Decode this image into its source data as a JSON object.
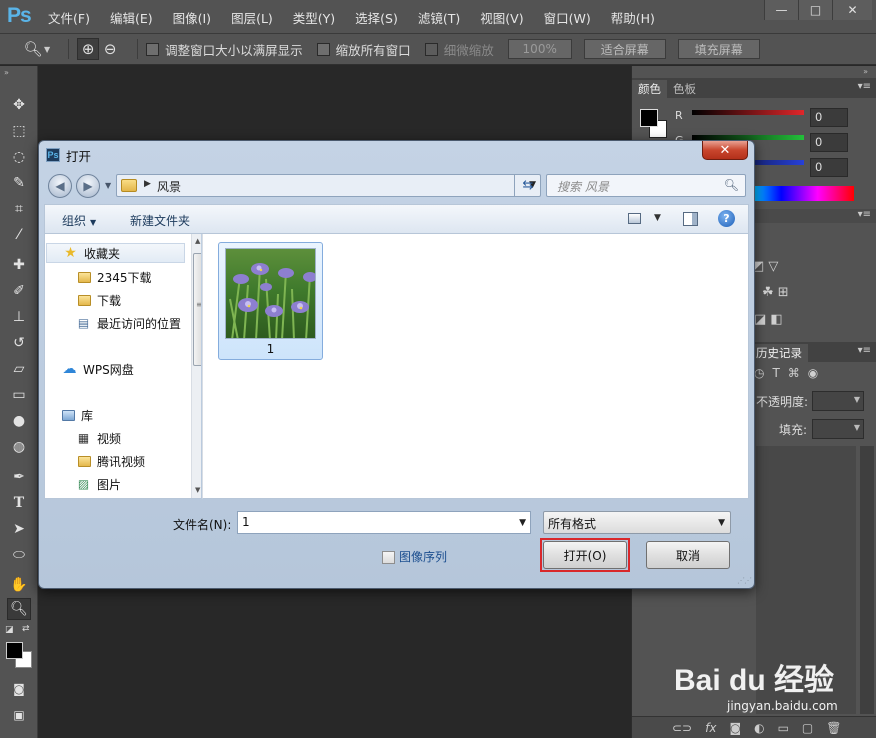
{
  "app": {
    "logo": "Ps",
    "menu": [
      "文件(F)",
      "编辑(E)",
      "图像(I)",
      "图层(L)",
      "类型(Y)",
      "选择(S)",
      "滤镜(T)",
      "视图(V)",
      "窗口(W)",
      "帮助(H)"
    ],
    "window_controls": {
      "minimize": "—",
      "maximize": "□",
      "close": "✕"
    }
  },
  "options_bar": {
    "resize_windows": "调整窗口大小以满屏显示",
    "zoom_all": "缩放所有窗口",
    "scrubby_zoom": "细微缩放",
    "zoom_value": "100%",
    "fit_screen": "适合屏幕",
    "fill_screen": "填充屏幕"
  },
  "color_panel": {
    "tabs": [
      "颜色",
      "色板"
    ],
    "channels": [
      {
        "label": "R",
        "value": "0",
        "color": "#e0262a"
      },
      {
        "label": "G",
        "value": "0",
        "color": "#23c03a"
      },
      {
        "label": "B",
        "value": "0",
        "color": "#2740d8"
      }
    ]
  },
  "layers_panel": {
    "tab": "历史记录",
    "opacity_label": "不透明度:",
    "fill_label": "填充:"
  },
  "dialog": {
    "title": "打开",
    "close_label": "✕",
    "address": "风景",
    "search_placeholder": "搜索 风景",
    "organize": "组织",
    "new_folder": "新建文件夹",
    "nav_items": [
      {
        "label": "收藏夹",
        "icon": "star-icon"
      },
      {
        "label": "2345下载",
        "icon": "folder-icon"
      },
      {
        "label": "下载",
        "icon": "folder-icon"
      },
      {
        "label": "最近访问的位置",
        "icon": "recent-places-icon"
      },
      {
        "label": "WPS网盘",
        "icon": "cloud-icon"
      },
      {
        "label": "库",
        "icon": "library-icon"
      },
      {
        "label": "视频",
        "icon": "film-icon"
      },
      {
        "label": "腾讯视频",
        "icon": "folder-icon"
      },
      {
        "label": "图片",
        "icon": "picture-icon"
      }
    ],
    "files": [
      {
        "name": "1"
      }
    ],
    "filename_label": "文件名(N):",
    "filename_value": "1",
    "filetype_value": "所有格式",
    "image_sequence": "图像序列",
    "open_button": "打开(O)",
    "cancel_button": "取消"
  },
  "watermark": {
    "brand": "Bai du 经验",
    "url": "jingyan.baidu.com"
  }
}
